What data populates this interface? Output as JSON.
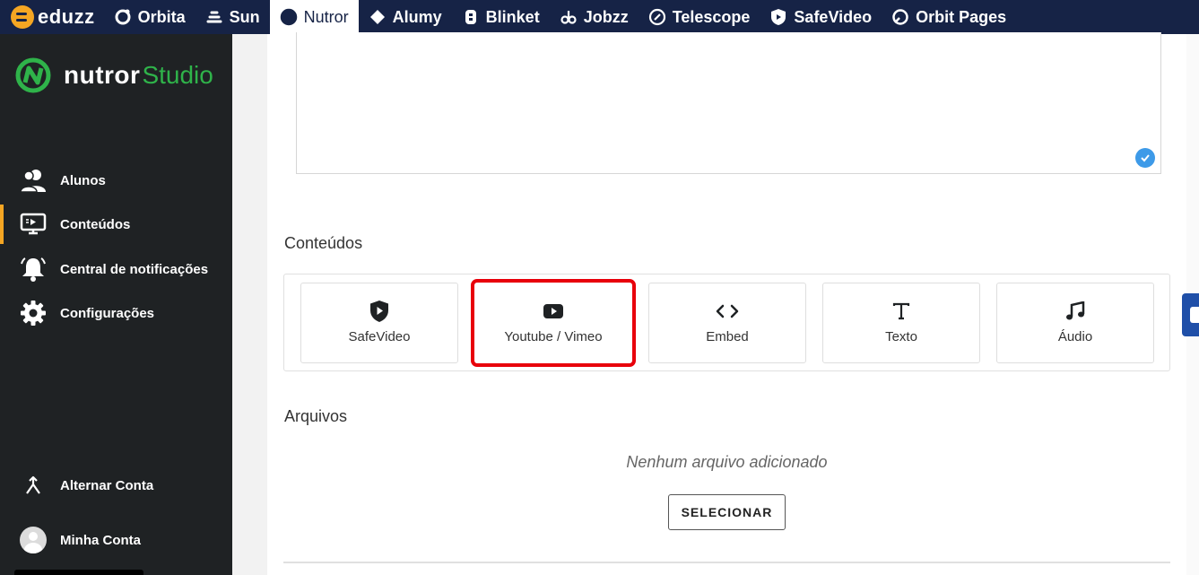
{
  "topbar": {
    "brand": "eduzz",
    "tabs": [
      {
        "label": "Orbita",
        "icon": "orbita-icon"
      },
      {
        "label": "Sun",
        "icon": "sun-icon"
      },
      {
        "label": "Nutror",
        "icon": "nutror-icon",
        "active": true
      },
      {
        "label": "Alumy",
        "icon": "alumy-icon"
      },
      {
        "label": "Blinket",
        "icon": "blinket-icon"
      },
      {
        "label": "Jobzz",
        "icon": "jobzz-icon"
      },
      {
        "label": "Telescope",
        "icon": "telescope-icon"
      },
      {
        "label": "SafeVideo",
        "icon": "safevideo-icon"
      },
      {
        "label": "Orbit Pages",
        "icon": "orbit-pages-icon"
      }
    ]
  },
  "sidebar": {
    "logo_main": "nutror",
    "logo_sub": "Studio",
    "items": [
      {
        "label": "Alunos",
        "icon": "students-icon"
      },
      {
        "label": "Conteúdos",
        "icon": "contents-icon",
        "active": true
      },
      {
        "label": "Central de notificações",
        "icon": "bell-icon"
      },
      {
        "label": "Configurações",
        "icon": "gear-icon"
      }
    ],
    "bottom": [
      {
        "label": "Alternar Conta",
        "icon": "switch-account-icon"
      },
      {
        "label": "Minha Conta",
        "icon": "avatar"
      }
    ]
  },
  "main": {
    "contents_heading": "Conteúdos",
    "content_types": [
      {
        "label": "SafeVideo",
        "icon": "shield-play-icon"
      },
      {
        "label": "Youtube / Vimeo",
        "icon": "youtube-icon",
        "highlighted": true
      },
      {
        "label": "Embed",
        "icon": "code-icon"
      },
      {
        "label": "Texto",
        "icon": "text-icon"
      },
      {
        "label": "Áudio",
        "icon": "music-note-icon"
      }
    ],
    "files_heading": "Arquivos",
    "files_empty": "Nenhum arquivo adicionado",
    "select_button": "SELECIONAR"
  },
  "colors": {
    "topbar_bg": "#162346",
    "sidebar_bg": "#1f2224",
    "accent_orange": "#f5a623",
    "brand_green": "#2fb34a",
    "highlight_red": "#e8000b"
  }
}
